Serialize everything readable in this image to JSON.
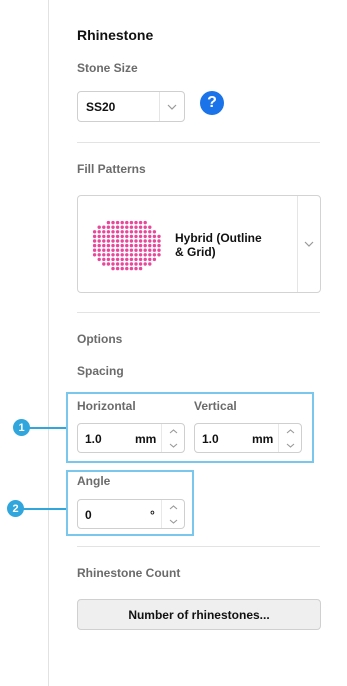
{
  "panel": {
    "title": "Rhinestone"
  },
  "stone_size": {
    "label": "Stone Size",
    "value": "SS20",
    "help_icon": "?"
  },
  "fill_patterns": {
    "label": "Fill Patterns",
    "selected": "Hybrid (Outline & Grid)",
    "selected_line1": "Hybrid (Outline",
    "selected_line2": "& Grid)",
    "preview_color": "#e8479a"
  },
  "options": {
    "label": "Options",
    "spacing_label": "Spacing",
    "horizontal": {
      "label": "Horizontal",
      "value": "1.0",
      "unit": "mm"
    },
    "vertical": {
      "label": "Vertical",
      "value": "1.0",
      "unit": "mm"
    },
    "angle": {
      "label": "Angle",
      "value": "0",
      "unit": "°"
    }
  },
  "callouts": {
    "one": "1",
    "two": "2",
    "color": "#30a6dc"
  },
  "rhinestone_count": {
    "label": "Rhinestone Count",
    "button": "Number of rhinestones..."
  }
}
